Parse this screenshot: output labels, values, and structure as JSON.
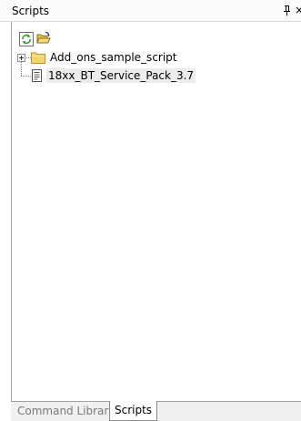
{
  "window": {
    "title": "Scripts",
    "close_glyph": "×"
  },
  "toolbar": {
    "buttons": [
      {
        "name": "refresh-scripts-button",
        "icon": "refresh-icon"
      },
      {
        "name": "open-folder-button",
        "icon": "open-folder-icon"
      }
    ]
  },
  "tree": {
    "items": [
      {
        "label": "Add_ons_sample_script",
        "icon": "folder-icon",
        "expandable": true
      },
      {
        "label": "18xx_BT_Service_Pack_3.7",
        "icon": "document-icon",
        "selected": true
      }
    ]
  },
  "tabs": [
    {
      "label": "Command Library",
      "active": false
    },
    {
      "label": "Scripts",
      "active": true
    }
  ],
  "colors": {
    "folder": "#f4d66a",
    "refresh": "#2e9a2e",
    "selection": "#ececec"
  }
}
